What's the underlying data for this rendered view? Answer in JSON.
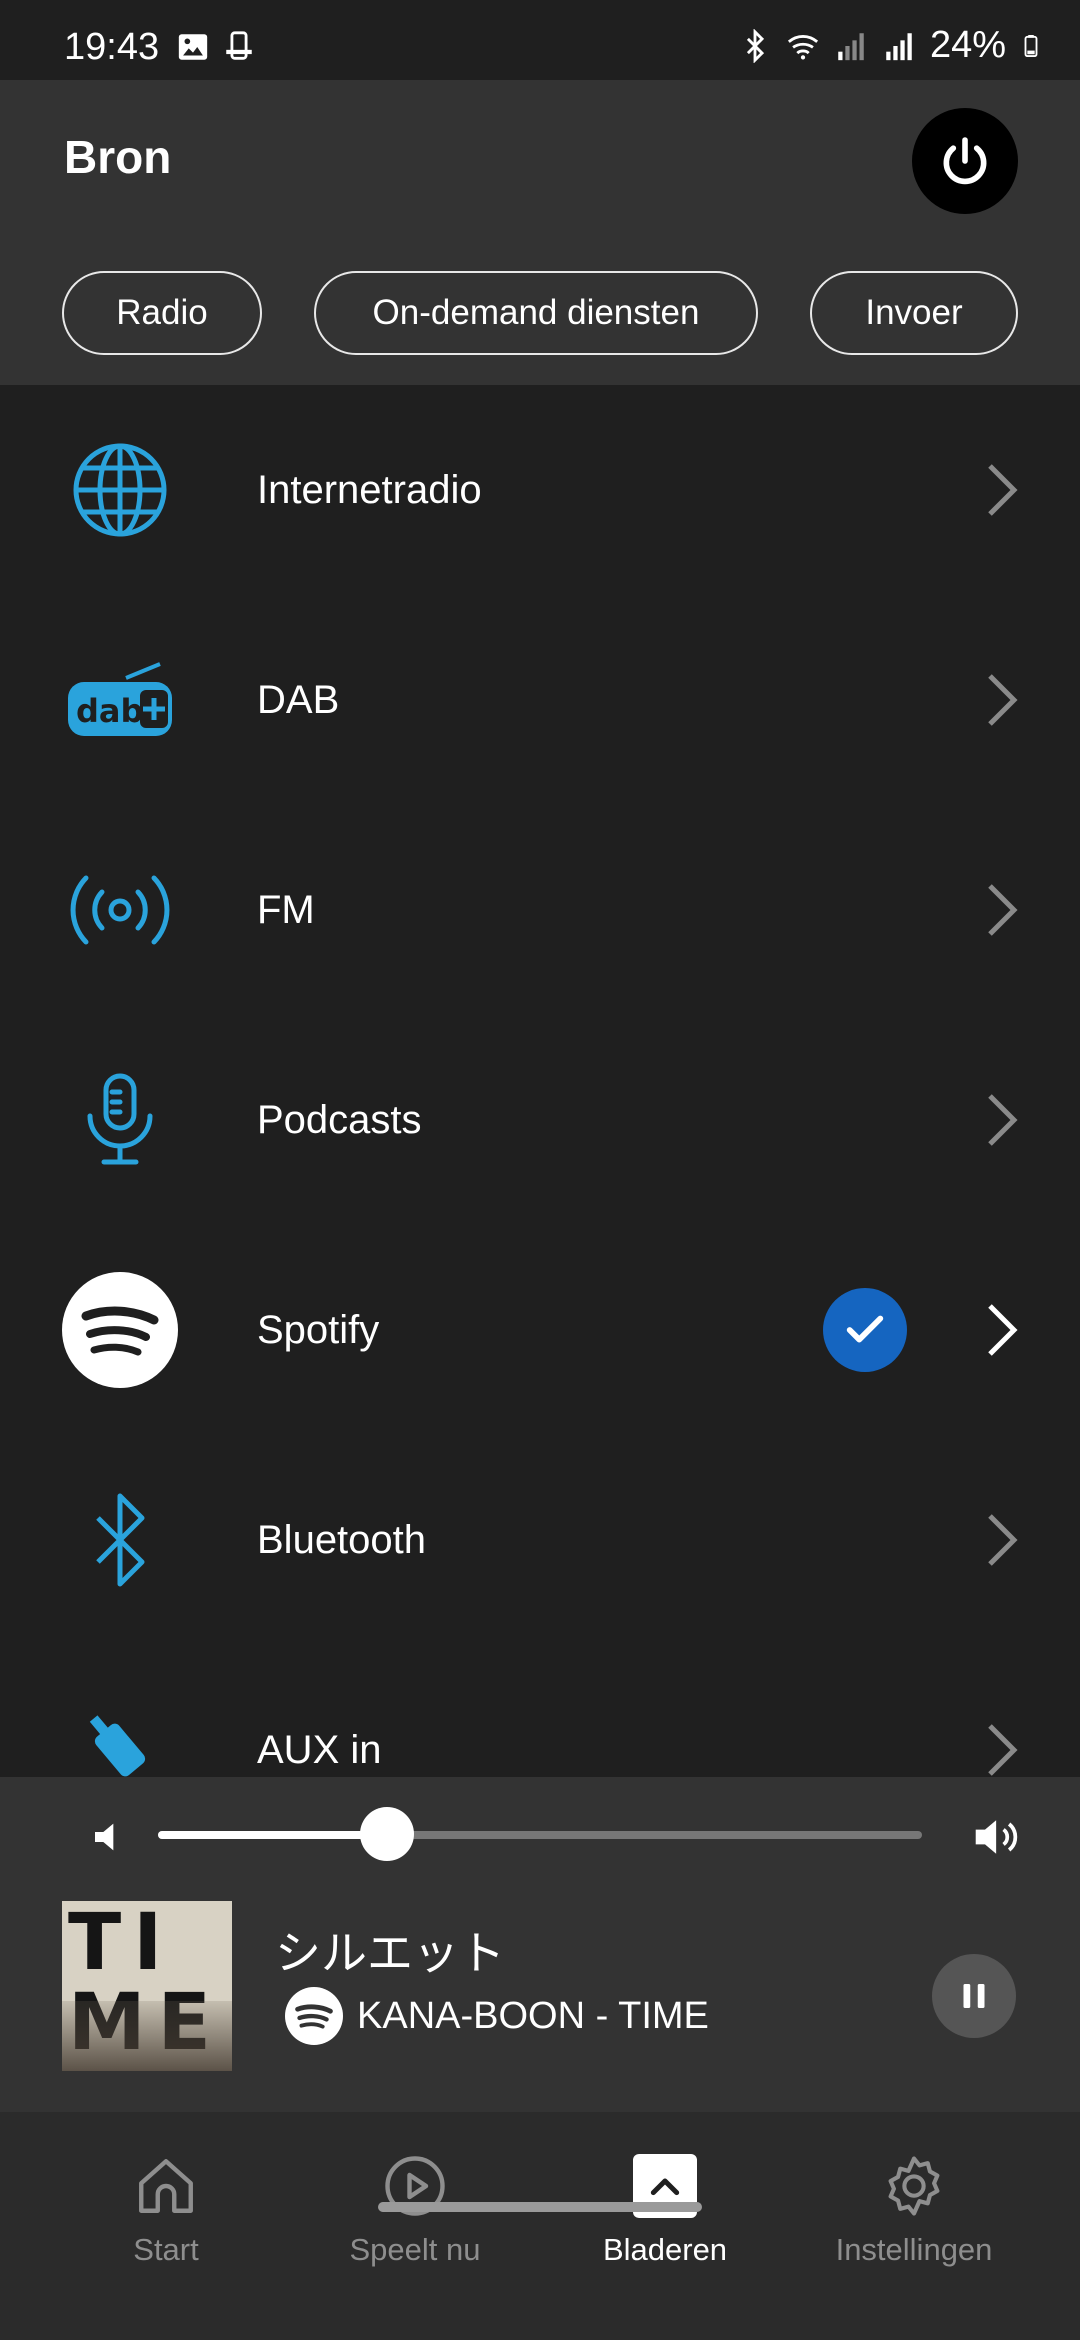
{
  "status_bar": {
    "time": "19:43",
    "battery": "24%",
    "left_icons": [
      "image-icon",
      "device-icon"
    ],
    "right_icons": [
      "bluetooth-icon",
      "wifi-icon",
      "signal-icon",
      "signal-icon",
      "battery-icon"
    ]
  },
  "header": {
    "title": "Bron",
    "power_icon": "power-icon",
    "chips": [
      {
        "label": "Radio"
      },
      {
        "label": "On-demand diensten"
      },
      {
        "label": "Invoer"
      }
    ]
  },
  "sources": [
    {
      "label": "Internetradio",
      "icon": "globe-icon"
    },
    {
      "label": "DAB",
      "icon": "dab-plus-icon"
    },
    {
      "label": "FM",
      "icon": "fm-broadcast-icon"
    },
    {
      "label": "Podcasts",
      "icon": "microphone-icon"
    },
    {
      "label": "Spotify",
      "icon": "spotify-icon",
      "selected": true
    },
    {
      "label": "Bluetooth",
      "icon": "bluetooth-icon"
    },
    {
      "label": "AUX in",
      "icon": "aux-cable-icon"
    }
  ],
  "player": {
    "volume_fraction": 0.3,
    "track_title": "シルエット",
    "track_artist": "KANA-BOON - TIME",
    "album_art_letters": "TIME",
    "service_icon": "spotify-icon",
    "pause_icon": "pause-icon"
  },
  "bottom_nav": [
    {
      "label": "Start",
      "icon": "home-icon"
    },
    {
      "label": "Speelt nu",
      "icon": "play-circle-icon"
    },
    {
      "label": "Bladeren",
      "icon": "browse-icon",
      "active": true
    },
    {
      "label": "Instellingen",
      "icon": "gear-icon"
    }
  ],
  "colors": {
    "accent": "#2aa3dc",
    "selected_badge": "#1565c0",
    "header_bg": "#333333",
    "list_bg": "#1f1f1f"
  }
}
